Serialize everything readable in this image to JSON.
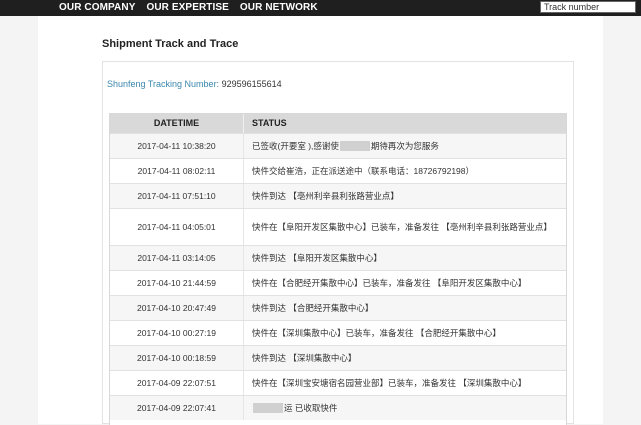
{
  "nav": {
    "items": [
      "OUR COMPANY",
      "OUR EXPERTISE",
      "OUR NETWORK"
    ],
    "search_placeholder": "Track number"
  },
  "title": "Shipment Track and Trace",
  "tracking": {
    "label": "Shunfeng Tracking Number:",
    "number": "929596155614"
  },
  "table": {
    "headers": [
      "DATETIME",
      "STATUS"
    ],
    "rows": [
      {
        "datetime": "2017-04-11 10:38:20",
        "status_pre": "已签收(开要室 ),感谢使",
        "status_post": "期待再次为您服务"
      },
      {
        "datetime": "2017-04-11 08:02:11",
        "status": "快件交给崔浩，正在派送途中（联系电话：18726792198）"
      },
      {
        "datetime": "2017-04-11 07:51:10",
        "status": "快件到达 【亳州利辛县利张路营业点】"
      },
      {
        "datetime": "2017-04-11 04:05:01",
        "status": "快件在【阜阳开发区集散中心】已装车，准备发往 【亳州利辛县利张路营业点】"
      },
      {
        "datetime": "2017-04-11 03:14:05",
        "status": "快件到达 【阜阳开发区集散中心】"
      },
      {
        "datetime": "2017-04-10 21:44:59",
        "status": "快件在【合肥经开集散中心】已装车，准备发往 【阜阳开发区集散中心】"
      },
      {
        "datetime": "2017-04-10 20:47:49",
        "status": "快件到达 【合肥经开集散中心】"
      },
      {
        "datetime": "2017-04-10 00:27:19",
        "status": "快件在【深圳集散中心】已装车，准备发往 【合肥经开集散中心】"
      },
      {
        "datetime": "2017-04-10 00:18:59",
        "status": "快件到达 【深圳集散中心】"
      },
      {
        "datetime": "2017-04-09 22:07:51",
        "status": "快件在【深圳宝安塘宿名园营业部】已装车，准备发往 【深圳集散中心】"
      },
      {
        "datetime": "2017-04-09 22:07:41",
        "status_pre": "",
        "status_post": "运 已收取快件"
      }
    ]
  }
}
